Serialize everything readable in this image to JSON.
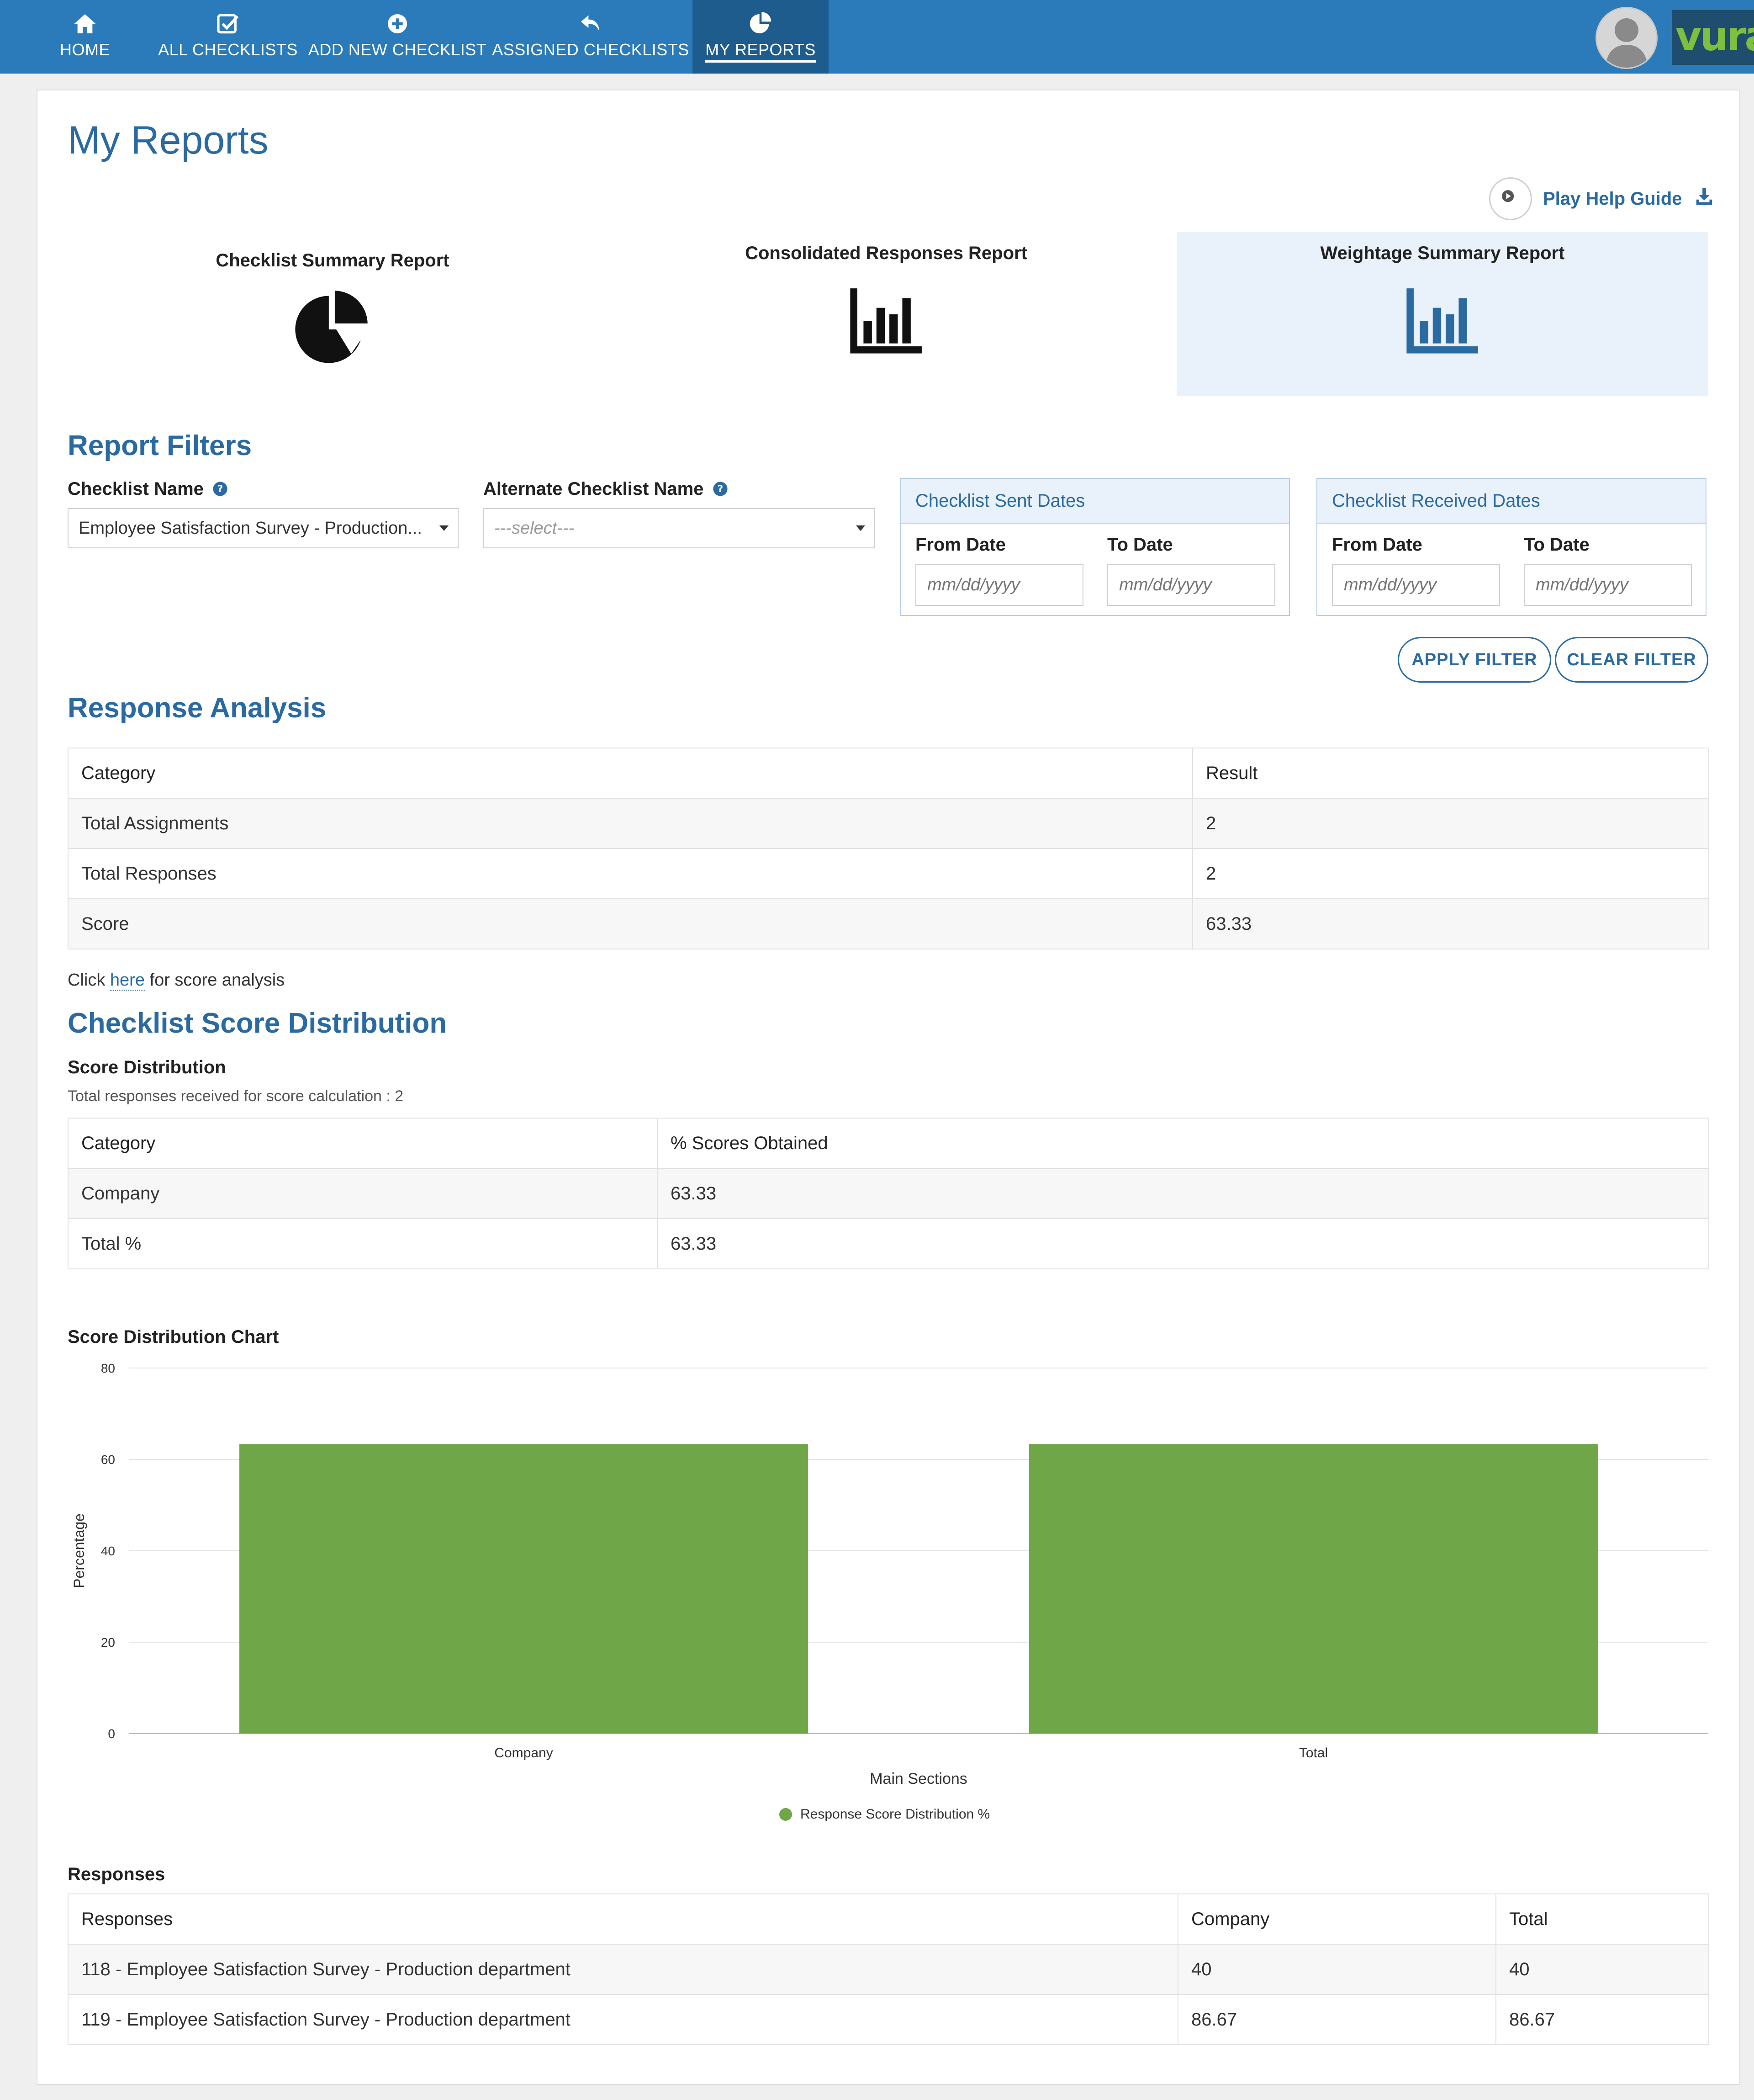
{
  "nav": {
    "items": [
      {
        "label": "HOME",
        "icon": "home-icon"
      },
      {
        "label": "ALL CHECKLISTS",
        "icon": "checklist-icon"
      },
      {
        "label": "ADD NEW CHECKLIST",
        "icon": "plus-circle-icon"
      },
      {
        "label": "ASSIGNED CHECKLISTS",
        "icon": "reply-icon"
      },
      {
        "label": "MY REPORTS",
        "icon": "pie-chart-icon",
        "active": true
      }
    ],
    "logo_text": "vuram"
  },
  "page": {
    "title": "My Reports",
    "help_link": "Play Help Guide"
  },
  "report_types": [
    {
      "title": "Checklist Summary Report",
      "icon": "pie-chart-icon"
    },
    {
      "title": "Consolidated Responses Report",
      "icon": "bar-chart-icon"
    },
    {
      "title": "Weightage Summary Report",
      "icon": "bar-chart-icon",
      "active": true
    }
  ],
  "filters": {
    "title": "Report Filters",
    "checklist_name_label": "Checklist Name",
    "checklist_name_value": "Employee Satisfaction Survey - Production...",
    "alt_checklist_name_label": "Alternate Checklist Name",
    "alt_checklist_name_value": "---select---",
    "sent_dates": {
      "title": "Checklist Sent Dates",
      "from_label": "From Date",
      "to_label": "To Date",
      "from_placeholder": "mm/dd/yyyy",
      "to_placeholder": "mm/dd/yyyy"
    },
    "received_dates": {
      "title": "Checklist Received Dates",
      "from_label": "From Date",
      "to_label": "To Date",
      "from_placeholder": "mm/dd/yyyy",
      "to_placeholder": "mm/dd/yyyy"
    },
    "apply_label": "APPLY FILTER",
    "clear_label": "CLEAR FILTER"
  },
  "response_analysis": {
    "title": "Response Analysis",
    "headers": [
      "Category",
      "Result"
    ],
    "rows": [
      [
        "Total Assignments",
        "2"
      ],
      [
        "Total Responses",
        "2"
      ],
      [
        "Score",
        "63.33"
      ]
    ],
    "note_prefix": "Click",
    "note_link": "here",
    "note_suffix": "for score analysis"
  },
  "score_distribution": {
    "title": "Checklist Score Distribution",
    "subtitle": "Score Distribution",
    "caption": "Total responses received for score calculation : 2",
    "headers": [
      "Category",
      "% Scores Obtained"
    ],
    "rows": [
      [
        "Company",
        "63.33"
      ],
      [
        "Total %",
        "63.33"
      ]
    ],
    "chart_title": "Score Distribution Chart"
  },
  "chart_data": {
    "type": "bar",
    "title": "Score Distribution Chart",
    "categories": [
      "Company",
      "Total"
    ],
    "series": [
      {
        "name": "Response Score Distribution %",
        "values": [
          63.33,
          63.33
        ],
        "color": "#6ea648"
      }
    ],
    "xlabel": "Main Sections",
    "ylabel": "Percentage",
    "ylim": [
      0,
      80
    ],
    "yticks": [
      0,
      20,
      40,
      60,
      80
    ],
    "grid": true,
    "legend": "bottom-center"
  },
  "responses": {
    "title": "Responses",
    "headers": [
      "Responses",
      "Company",
      "Total"
    ],
    "rows": [
      [
        "118 - Employee Satisfaction Survey - Production department",
        "40",
        "40"
      ],
      [
        "119 - Employee Satisfaction Survey - Production department",
        "86.67",
        "86.67"
      ]
    ]
  },
  "colors": {
    "nav_bg": "#2b7bba",
    "accent": "#2a6aa1",
    "bar": "#6ea648"
  }
}
